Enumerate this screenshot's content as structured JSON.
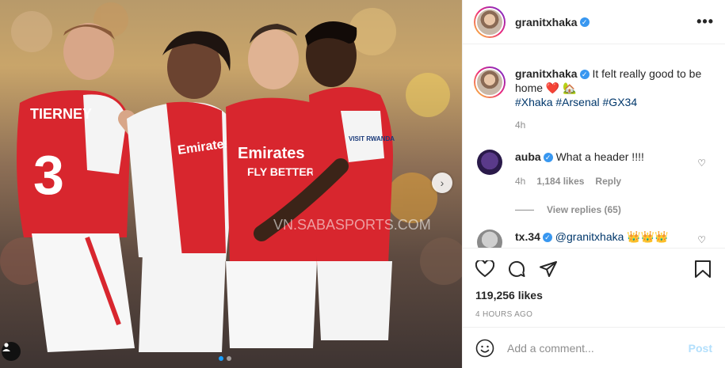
{
  "post": {
    "author": "granitxhaka",
    "more_label": "•••",
    "caption_text": " It felt really good to be home ",
    "caption_emoji": "❤️ 🏡",
    "hashtags": "#Xhaka #Arsenal #GX34",
    "caption_time": "4h",
    "likes": "119,256 likes",
    "posted_ago": "4 HOURS AGO"
  },
  "photo": {
    "watermark": "VN.SABASPORTS.COM",
    "jersey_sponsor_1": "Emirates",
    "jersey_sponsor_2": "FLY BETTER",
    "shirt_name": "TIERNEY",
    "shirt_number": "3",
    "sleeve_text": "VISIT RWANDA",
    "carousel_total": 2,
    "carousel_active": 1
  },
  "comments": [
    {
      "user": "auba",
      "text": " What a header !!!!",
      "time": "4h",
      "likes": "1,184 likes",
      "reply_label": "Reply",
      "view_replies": "View replies (65)"
    },
    {
      "user": "tx.34",
      "mention": " @granitxhaka",
      "emoji": " 👑👑👑"
    }
  ],
  "add_comment": {
    "placeholder": "Add a comment...",
    "post_label": "Post"
  },
  "colors": {
    "link": "#00376b",
    "verified": "#3897f0",
    "meta": "#8e8e8e",
    "post_disabled": "#b2dffc"
  }
}
